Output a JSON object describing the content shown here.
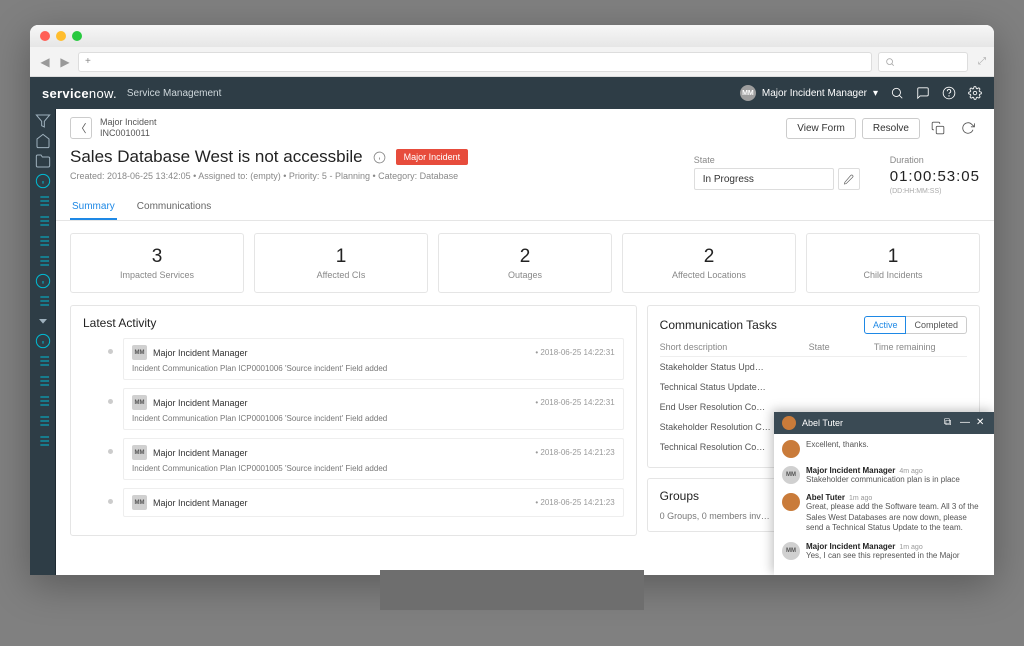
{
  "browser": {
    "url_prefix": "+"
  },
  "header": {
    "logo_a": "service",
    "logo_b": "now.",
    "app": "Service Management",
    "user_initials": "MM",
    "user_name": "Major Incident Manager"
  },
  "record": {
    "type": "Major Incident",
    "number": "INC0010011",
    "title": "Sales Database West is not accessbile",
    "badge": "Major Incident",
    "meta": "Created: 2018-06-25 13:42:05 • Assigned to: (empty) • Priority: 5 - Planning • Category: Database",
    "state_label": "State",
    "state_value": "In Progress",
    "duration_label": "Duration",
    "duration_value": "01:00:53:05",
    "duration_sub": "(DD:HH:MM:SS)",
    "btn_view_form": "View Form",
    "btn_resolve": "Resolve"
  },
  "tabs": {
    "summary": "Summary",
    "communications": "Communications"
  },
  "kpis": [
    {
      "num": "3",
      "label": "Impacted Services"
    },
    {
      "num": "1",
      "label": "Affected CIs"
    },
    {
      "num": "2",
      "label": "Outages"
    },
    {
      "num": "2",
      "label": "Affected Locations"
    },
    {
      "num": "1",
      "label": "Child Incidents"
    }
  ],
  "activity": {
    "title": "Latest Activity",
    "items": [
      {
        "av": "MM",
        "who": "Major Incident Manager",
        "time": "2018-06-25 14:22:31",
        "body": "Incident Communication Plan ICP0001006 'Source incident' Field added"
      },
      {
        "av": "MM",
        "who": "Major Incident Manager",
        "time": "2018-06-25 14:22:31",
        "body": "Incident Communication Plan ICP0001006 'Source incident' Field added"
      },
      {
        "av": "MM",
        "who": "Major Incident Manager",
        "time": "2018-06-25 14:21:23",
        "body": "Incident Communication Plan ICP0001005 'Source incident' Field added"
      },
      {
        "av": "MM",
        "who": "Major Incident Manager",
        "time": "2018-06-25 14:21:23",
        "body": ""
      }
    ]
  },
  "comm_tasks": {
    "title": "Communication Tasks",
    "toggle_active": "Active",
    "toggle_completed": "Completed",
    "col1": "Short description",
    "col2": "State",
    "col3": "Time remaining",
    "rows": [
      "Stakeholder Status Upd…",
      "Technical Status Update…",
      "End User Resolution Co…",
      "Stakeholder Resolution C…",
      "Technical Resolution Co…"
    ]
  },
  "groups": {
    "title": "Groups",
    "body": "0 Groups, 0 members inv…"
  },
  "chat": {
    "header_name": "Abel Tuter",
    "messages": [
      {
        "kind": "abel",
        "name": "",
        "time": "",
        "text": "Excellent, thanks."
      },
      {
        "kind": "mim",
        "av": "MM",
        "name": "Major Incident Manager",
        "time": "4m ago",
        "text": "Stakeholder communication plan is in place"
      },
      {
        "kind": "abel",
        "name": "Abel Tuter",
        "time": "1m ago",
        "text": "Great, please add the Software team. All 3 of the Sales West Databases are now down, please send a Technical Status Update to the team."
      },
      {
        "kind": "mim",
        "av": "MM",
        "name": "Major Incident Manager",
        "time": "1m ago",
        "text": "Yes, I can see this represented in the Major"
      }
    ]
  }
}
